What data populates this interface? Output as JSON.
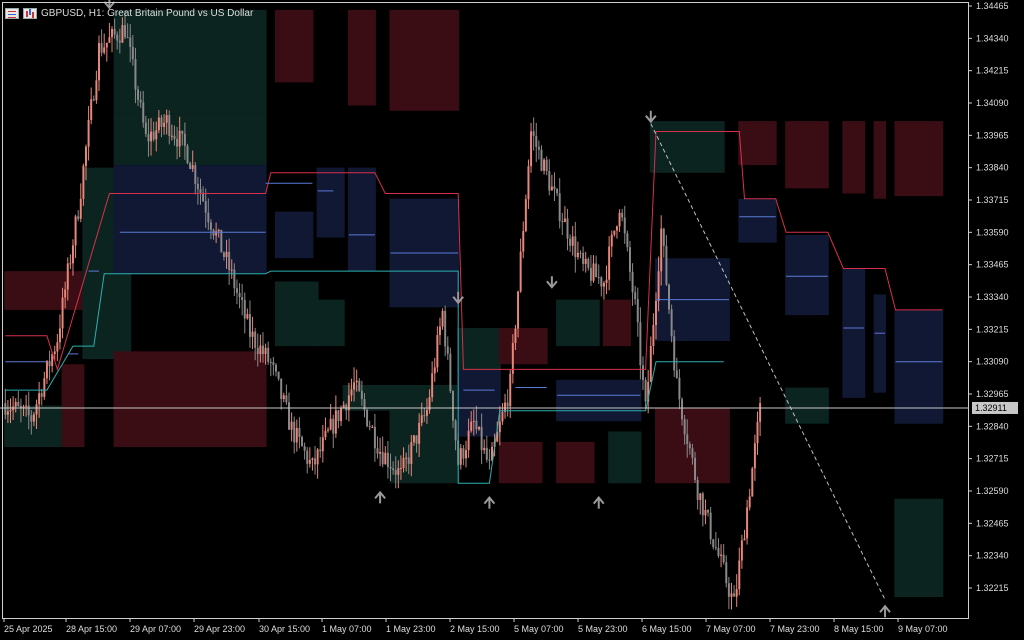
{
  "header": {
    "symbol_label": "GBPUSD, H1:  Great Britain Pound vs US Dollar",
    "icons": [
      "market-watch-icon",
      "chart-type-icon"
    ]
  },
  "colors": {
    "background": "#000000",
    "bull_candle": "#e8877a",
    "bear_candle": "#8a8a8a",
    "box_red": "#3a0d14",
    "box_navy": "#101833",
    "box_teal": "#0b2420",
    "level_line": "#5a7ad8",
    "upper_line": "#d8304a",
    "lower_line": "#2ab0b0",
    "price_line": "#c8c8c8",
    "arrow": "#9a9a9a"
  },
  "chart_data": {
    "type": "candlestick",
    "y_ticks": [
      "1.34465",
      "1.34340",
      "1.34215",
      "1.34090",
      "1.33965",
      "1.33840",
      "1.33715",
      "1.33590",
      "1.33465",
      "1.33340",
      "1.33215",
      "1.33090",
      "1.32965",
      "1.32840",
      "1.32715",
      "1.32590",
      "1.32465",
      "1.32340",
      "1.32215"
    ],
    "x_ticks": [
      "25 Apr 2025",
      "28 Apr 15:00",
      "29 Apr 07:00",
      "29 Apr 23:00",
      "30 Apr 15:00",
      "1 May 07:00",
      "1 May 23:00",
      "2 May 15:00",
      "5 May 07:00",
      "5 May 23:00",
      "6 May 15:00",
      "7 May 07:00",
      "7 May 23:00",
      "8 May 15:00",
      "9 May 07:00"
    ],
    "ylim": [
      1.3215,
      1.3449
    ],
    "current_price": "1.32911",
    "anchors": [
      [
        0,
        1.3293
      ],
      [
        10,
        1.3287
      ],
      [
        20,
        1.3318
      ],
      [
        28,
        1.3368
      ],
      [
        36,
        1.343
      ],
      [
        46,
        1.3438
      ],
      [
        54,
        1.3395
      ],
      [
        62,
        1.3402
      ],
      [
        70,
        1.339
      ],
      [
        78,
        1.3366
      ],
      [
        86,
        1.3345
      ],
      [
        94,
        1.332
      ],
      [
        102,
        1.3308
      ],
      [
        110,
        1.3283
      ],
      [
        118,
        1.3268
      ],
      [
        126,
        1.3285
      ],
      [
        134,
        1.33
      ],
      [
        144,
        1.3275
      ],
      [
        152,
        1.3265
      ],
      [
        162,
        1.329
      ],
      [
        168,
        1.3328
      ],
      [
        174,
        1.327
      ],
      [
        180,
        1.3285
      ],
      [
        186,
        1.3268
      ],
      [
        194,
        1.33
      ],
      [
        202,
        1.3398
      ],
      [
        212,
        1.337
      ],
      [
        222,
        1.3345
      ],
      [
        230,
        1.334
      ],
      [
        236,
        1.337
      ],
      [
        242,
        1.333
      ],
      [
        246,
        1.329
      ],
      [
        252,
        1.336
      ],
      [
        258,
        1.33
      ],
      [
        266,
        1.326
      ],
      [
        272,
        1.324
      ],
      [
        280,
        1.3215
      ],
      [
        284,
        1.3245
      ],
      [
        290,
        1.329
      ]
    ],
    "boxes": [
      {
        "c": "box_red",
        "x": [
          0,
          30
        ],
        "y": [
          1.3344,
          1.3329
        ]
      },
      {
        "c": "box_teal",
        "x": [
          0,
          30
        ],
        "y": [
          1.3292,
          1.3276
        ]
      },
      {
        "c": "box_teal",
        "x": [
          30,
          48
        ],
        "y": [
          1.3384,
          1.331
        ]
      },
      {
        "c": "box_red",
        "x": [
          22,
          30
        ],
        "y": [
          1.3308,
          1.3276
        ]
      },
      {
        "c": "box_teal",
        "x": [
          42,
          100
        ],
        "y": [
          1.3445,
          1.3405
        ]
      },
      {
        "c": "box_teal",
        "x": [
          42,
          100
        ],
        "y": [
          1.3405,
          1.3385
        ]
      },
      {
        "c": "box_navy",
        "x": [
          42,
          100
        ],
        "y": [
          1.3385,
          1.3343
        ]
      },
      {
        "c": "box_red",
        "x": [
          42,
          100
        ],
        "y": [
          1.3313,
          1.3276
        ]
      },
      {
        "c": "box_red",
        "x": [
          104,
          118
        ],
        "y": [
          1.3445,
          1.3417
        ]
      },
      {
        "c": "box_red",
        "x": [
          132,
          142
        ],
        "y": [
          1.3445,
          1.3408
        ]
      },
      {
        "c": "box_red",
        "x": [
          148,
          174
        ],
        "y": [
          1.3445,
          1.3406
        ]
      },
      {
        "c": "box_navy",
        "x": [
          104,
          118
        ],
        "y": [
          1.3367,
          1.3349
        ]
      },
      {
        "c": "box_navy",
        "x": [
          120,
          130
        ],
        "y": [
          1.3384,
          1.3357
        ]
      },
      {
        "c": "box_navy",
        "x": [
          132,
          142
        ],
        "y": [
          1.3384,
          1.3344
        ]
      },
      {
        "c": "box_navy",
        "x": [
          148,
          174
        ],
        "y": [
          1.3372,
          1.333
        ]
      },
      {
        "c": "box_teal",
        "x": [
          104,
          120
        ],
        "y": [
          1.334,
          1.3315
        ]
      },
      {
        "c": "box_teal",
        "x": [
          120,
          130
        ],
        "y": [
          1.3333,
          1.3315
        ]
      },
      {
        "c": "box_teal",
        "x": [
          130,
          148
        ],
        "y": [
          1.33,
          1.329
        ]
      },
      {
        "c": "box_teal",
        "x": [
          148,
          174
        ],
        "y": [
          1.33,
          1.3262
        ]
      },
      {
        "c": "box_teal",
        "x": [
          174,
          190
        ],
        "y": [
          1.3322,
          1.3305
        ]
      },
      {
        "c": "box_red",
        "x": [
          190,
          208
        ],
        "y": [
          1.3322,
          1.3308
        ]
      },
      {
        "c": "box_teal",
        "x": [
          212,
          228
        ],
        "y": [
          1.3333,
          1.3315
        ]
      },
      {
        "c": "box_red",
        "x": [
          230,
          240
        ],
        "y": [
          1.3333,
          1.3315
        ]
      },
      {
        "c": "box_red",
        "x": [
          190,
          206
        ],
        "y": [
          1.3278,
          1.3262
        ]
      },
      {
        "c": "box_red",
        "x": [
          212,
          226
        ],
        "y": [
          1.3278,
          1.3262
        ]
      },
      {
        "c": "box_teal",
        "x": [
          232,
          244
        ],
        "y": [
          1.3282,
          1.3262
        ]
      },
      {
        "c": "box_navy",
        "x": [
          174,
          190
        ],
        "y": [
          1.3306,
          1.328
        ]
      },
      {
        "c": "box_navy",
        "x": [
          212,
          244
        ],
        "y": [
          1.3302,
          1.3286
        ]
      },
      {
        "c": "box_teal",
        "x": [
          248,
          276
        ],
        "y": [
          1.3402,
          1.3382
        ]
      },
      {
        "c": "box_red",
        "x": [
          282,
          296
        ],
        "y": [
          1.3402,
          1.3385
        ]
      },
      {
        "c": "box_red",
        "x": [
          300,
          316
        ],
        "y": [
          1.3402,
          1.3376
        ]
      },
      {
        "c": "box_red",
        "x": [
          322,
          330
        ],
        "y": [
          1.3402,
          1.3374
        ]
      },
      {
        "c": "box_red",
        "x": [
          334,
          338
        ],
        "y": [
          1.3402,
          1.3372
        ]
      },
      {
        "c": "box_red",
        "x": [
          342,
          360
        ],
        "y": [
          1.3402,
          1.3373
        ]
      },
      {
        "c": "box_navy",
        "x": [
          250,
          278
        ],
        "y": [
          1.3349,
          1.3317
        ]
      },
      {
        "c": "box_navy",
        "x": [
          282,
          296
        ],
        "y": [
          1.3372,
          1.3355
        ]
      },
      {
        "c": "box_navy",
        "x": [
          300,
          316
        ],
        "y": [
          1.3358,
          1.3327
        ]
      },
      {
        "c": "box_navy",
        "x": [
          322,
          330
        ],
        "y": [
          1.3345,
          1.3295
        ]
      },
      {
        "c": "box_navy",
        "x": [
          334,
          338
        ],
        "y": [
          1.3335,
          1.3297
        ]
      },
      {
        "c": "box_navy",
        "x": [
          342,
          360
        ],
        "y": [
          1.3329,
          1.3285
        ]
      },
      {
        "c": "box_red",
        "x": [
          250,
          278
        ],
        "y": [
          1.3291,
          1.3262
        ]
      },
      {
        "c": "box_teal",
        "x": [
          300,
          316
        ],
        "y": [
          1.3299,
          1.3285
        ]
      },
      {
        "c": "box_teal",
        "x": [
          342,
          360
        ],
        "y": [
          1.3256,
          1.3218
        ]
      }
    ],
    "upper_line": [
      [
        0,
        1.3319
      ],
      [
        16,
        1.3319
      ],
      [
        20,
        1.3306
      ],
      [
        40,
        1.3374
      ],
      [
        100,
        1.3374
      ],
      [
        102,
        1.3382
      ],
      [
        142,
        1.3382
      ],
      [
        146,
        1.3374
      ],
      [
        174,
        1.3374
      ],
      [
        176,
        1.3306
      ],
      [
        210,
        1.3306
      ],
      [
        212,
        1.3306
      ],
      [
        246,
        1.3306
      ],
      [
        250,
        1.3398
      ],
      [
        282,
        1.3398
      ],
      [
        284,
        1.3372
      ],
      [
        296,
        1.3372
      ],
      [
        300,
        1.3359
      ],
      [
        316,
        1.3359
      ],
      [
        322,
        1.3345
      ],
      [
        338,
        1.3345
      ],
      [
        342,
        1.3329
      ],
      [
        360,
        1.3329
      ]
    ],
    "lower_line": [
      [
        0,
        1.3298
      ],
      [
        16,
        1.3298
      ],
      [
        26,
        1.3315
      ],
      [
        34,
        1.3315
      ],
      [
        38,
        1.3343
      ],
      [
        100,
        1.3343
      ],
      [
        102,
        1.3344
      ],
      [
        174,
        1.3344
      ],
      [
        174,
        1.3262
      ],
      [
        186,
        1.3262
      ],
      [
        190,
        1.329
      ],
      [
        246,
        1.329
      ],
      [
        250,
        1.3309
      ],
      [
        276,
        1.3309
      ]
    ],
    "level_lines": [
      [
        [
          0,
          1.3309
        ],
        [
          16,
          1.3309
        ]
      ],
      [
        [
          24,
          1.3312
        ],
        [
          28,
          1.3312
        ]
      ],
      [
        [
          32,
          1.3344
        ],
        [
          36,
          1.3344
        ]
      ],
      [
        [
          44,
          1.3359
        ],
        [
          100,
          1.3359
        ]
      ],
      [
        [
          100,
          1.3378
        ],
        [
          118,
          1.3378
        ]
      ],
      [
        [
          120,
          1.3375
        ],
        [
          126,
          1.3375
        ]
      ],
      [
        [
          132,
          1.3358
        ],
        [
          142,
          1.3358
        ]
      ],
      [
        [
          148,
          1.3351
        ],
        [
          174,
          1.3351
        ]
      ],
      [
        [
          176,
          1.3298
        ],
        [
          188,
          1.3298
        ]
      ],
      [
        [
          196,
          1.3299
        ],
        [
          208,
          1.3299
        ]
      ],
      [
        [
          212,
          1.3296
        ],
        [
          244,
          1.3296
        ]
      ],
      [
        [
          250,
          1.3333
        ],
        [
          278,
          1.3333
        ]
      ],
      [
        [
          282,
          1.3365
        ],
        [
          296,
          1.3365
        ]
      ],
      [
        [
          300,
          1.3342
        ],
        [
          316,
          1.3342
        ]
      ],
      [
        [
          322,
          1.3322
        ],
        [
          330,
          1.3322
        ]
      ],
      [
        [
          334,
          1.332
        ],
        [
          338,
          1.332
        ]
      ],
      [
        [
          342,
          1.3309
        ],
        [
          360,
          1.3309
        ]
      ]
    ],
    "arrows_down": [
      [
        40,
        1.3445
      ],
      [
        174,
        1.3331
      ],
      [
        210,
        1.3337
      ],
      [
        248,
        1.3401
      ]
    ],
    "arrows_up": [
      [
        144,
        1.326
      ],
      [
        186,
        1.3258
      ],
      [
        228,
        1.3258
      ],
      [
        338,
        1.3216
      ]
    ],
    "trend_line": [
      [
        248,
        1.3401
      ],
      [
        338,
        1.3217
      ]
    ],
    "legend": "none",
    "grid": false
  }
}
